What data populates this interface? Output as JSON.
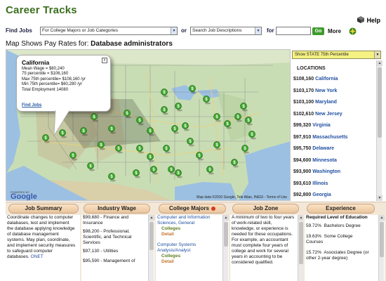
{
  "app": {
    "title": "Career Tracks",
    "help_label": "Help"
  },
  "findbar": {
    "find_jobs_label": "Find Jobs",
    "category_select": "For College Majors or Job Categories",
    "or_label": "or",
    "search_select": "Search Job Descriptions",
    "for_label": "for",
    "search_value": "",
    "go_label": "Go",
    "more_label": "More"
  },
  "map_heading": {
    "prefix": "Map Shows Pay Rates for: ",
    "occupation": "Database administrators"
  },
  "popup": {
    "state": "California",
    "lines": [
      "Mean Wage = $80,240",
      "75 percentile = $106,160",
      "Max 75th percentile= $108,160 /yr",
      "Min 75th percentile= $60,280 /yr",
      "Total Employment 14080"
    ],
    "link": "Find Jobs",
    "close": "x"
  },
  "map_footer": {
    "google": "Google",
    "powered_by": "POWERED BY",
    "copyright": "Map data ©2010 Google, Tele Atlas, INEGI - Terms of Use"
  },
  "locations": {
    "select_value": "Show STATE 75th Percentile",
    "header": "LOCATIONS",
    "rows": [
      {
        "amount": "$108,160",
        "state": "California"
      },
      {
        "amount": "$103,170",
        "state": "New York"
      },
      {
        "amount": "$103,100",
        "state": "Maryland"
      },
      {
        "amount": "$102,610",
        "state": "New Jersey"
      },
      {
        "amount": "$99,320",
        "state": "Virginia"
      },
      {
        "amount": "$97,910",
        "state": "Massachusetts"
      },
      {
        "amount": "$95,750",
        "state": "Delaware"
      },
      {
        "amount": "$94,600",
        "state": "Minnesota"
      },
      {
        "amount": "$93,900",
        "state": "Washington"
      },
      {
        "amount": "$93,610",
        "state": "Illinois"
      },
      {
        "amount": "$92,800",
        "state": "Georgia"
      }
    ]
  },
  "tabs": {
    "job_summary": "Job Summary",
    "industry_wage": "Industry Wage",
    "college_majors": "College Majors",
    "job_zone": "Job Zone",
    "experience": "Experience"
  },
  "job_summary": {
    "lines": [
      "Coordinate changes to computer",
      "databases, test and implement",
      "the database applying knowledge",
      "of database management",
      "systems. May plan, coordinate,",
      "and implement security measures",
      "to safeguard computer"
    ],
    "last_line": "databases.",
    "onet": "ONET"
  },
  "industry_wage": {
    "items": [
      {
        "l1": "$99,680 - Finance and",
        "l2": "Insurance"
      },
      {
        "l1": "$98,200 - Professional,",
        "l2": "Scientific, and Technical",
        "l3": "Services"
      },
      {
        "l1": "$97,130 - Utilities"
      },
      {
        "l1": "$95,590 - Management of"
      }
    ]
  },
  "college_majors": {
    "major1": [
      "Computer and Information",
      "Sciences, General"
    ],
    "colleges1": "Colleges",
    "detail1": "Detail",
    "major2": [
      "Computer Systems",
      "Analysis/Analyst"
    ],
    "colleges2": "Colleges",
    "detail2": "Detail"
  },
  "job_zone": {
    "lines": [
      "A minimum of two to four years",
      "of work-related skill,",
      "knowledge, or experience is",
      "needed for these occupations.",
      "For example, an accountant",
      "must complete four years of",
      "college and work for several",
      "years in accounting to be",
      "considered qualified."
    ]
  },
  "experience": {
    "header": "Required Level of Education",
    "items": [
      {
        "pct": "59.72%",
        "label": "Bachelors Degree"
      },
      {
        "pct": "19.63%",
        "label": "Some College",
        "label2": "Courses"
      },
      {
        "pct": "15.72%",
        "label": "Associates Degree (or",
        "label2": "other 2-year degree)"
      }
    ]
  },
  "colors": {
    "title_green": "#3b6e1e",
    "link_blue": "#1f4fa0",
    "map_pin_green": "#3fa82e",
    "tab_orange": "#e8c59e"
  },
  "icons": {
    "help": "cube-icon",
    "more": "compass-icon",
    "pin": "wage-pin-icon"
  }
}
